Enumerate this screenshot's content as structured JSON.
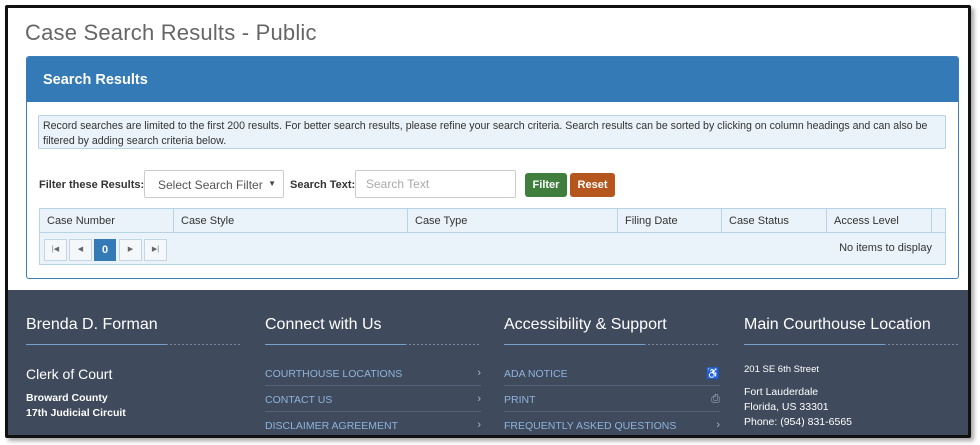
{
  "page": {
    "title": "Case Search Results - Public"
  },
  "panel": {
    "title": "Search Results",
    "info": "Record searches are limited to the first 200 results. For better search results, please refine your search criteria. Search results can be sorted by clicking on column headings and can also be filtered by adding search criteria below."
  },
  "filters": {
    "filter_label": "Filter these Results:",
    "select_value": "Select Search Filter",
    "search_label": "Search Text:",
    "search_placeholder": "Search Text",
    "search_value": "",
    "filter_button": "Filter",
    "reset_button": "Reset"
  },
  "grid": {
    "columns": [
      "Case Number",
      "Case Style",
      "Case Type",
      "Filing Date",
      "Case Status",
      "Access Level"
    ],
    "current_page": "0",
    "empty_message": "No items to display"
  },
  "footer": {
    "clerk": {
      "name": "Brenda D. Forman",
      "title": "Clerk of Court",
      "county": "Broward County",
      "circuit": "17th Judicial Circuit"
    },
    "connect": {
      "heading": "Connect with Us",
      "links": [
        "COURTHOUSE LOCATIONS",
        "CONTACT US",
        "DISCLAIMER AGREEMENT"
      ]
    },
    "accessibility": {
      "heading": "Accessibility & Support",
      "links": [
        "ADA NOTICE",
        "PRINT",
        "FREQUENTLY ASKED QUESTIONS"
      ]
    },
    "location": {
      "heading": "Main Courthouse Location",
      "street": "201 SE 6th Street",
      "city": "Fort Lauderdale",
      "state_zip": "Florida, US 33301",
      "phone": "Phone: (954) 831-6565"
    }
  },
  "colors": {
    "panel_header": "#337ab7",
    "filter_button": "#3f7e3c",
    "reset_button": "#b5561e",
    "footer_bg": "#3f4a5c"
  },
  "icons": [
    "first-page-icon",
    "previous-page-icon",
    "next-page-icon",
    "last-page-icon",
    "wheelchair-icon",
    "printer-icon",
    "chevron-right-icon"
  ]
}
